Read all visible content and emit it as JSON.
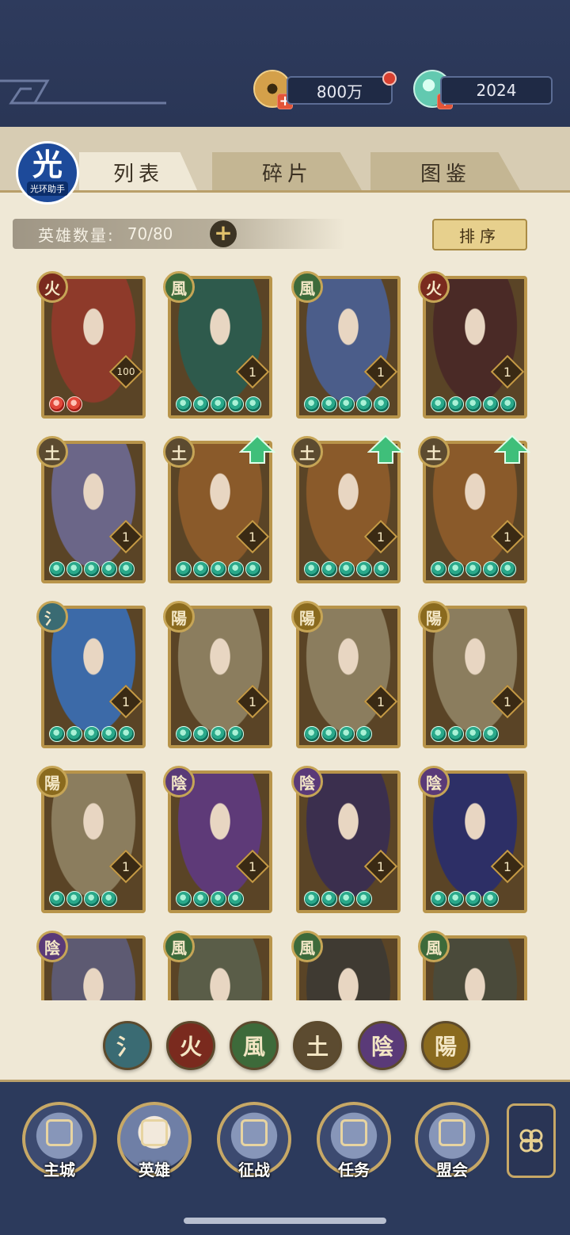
{
  "currencies": {
    "coins": {
      "value": "800万",
      "icon": "coin-icon"
    },
    "jade": {
      "value": "2024",
      "icon": "jade-icon"
    }
  },
  "tabs": [
    {
      "label": "列表",
      "active": true
    },
    {
      "label": "碎片",
      "active": false
    },
    {
      "label": "图鉴",
      "active": false
    }
  ],
  "watermark": {
    "big": "光",
    "small": "光环助手"
  },
  "hero_count": {
    "label": "英雄数量:",
    "value": "70/80"
  },
  "sort_label": "排序",
  "elements": {
    "water": {
      "glyph": "氵",
      "color": "#3a6b73"
    },
    "fire": {
      "glyph": "火",
      "color": "#7a2a1e"
    },
    "wind": {
      "glyph": "風",
      "color": "#3d6a3a"
    },
    "earth": {
      "glyph": "土",
      "color": "#5c4b30"
    },
    "yin": {
      "glyph": "陰",
      "color": "#5a3a78"
    },
    "yang": {
      "glyph": "陽",
      "color": "#8a6a1e"
    }
  },
  "heroes": [
    {
      "element": "fire",
      "level": "100",
      "stars": 2,
      "star_color": "red",
      "upgrade": false,
      "art": "#8e3a2a"
    },
    {
      "element": "wind",
      "level": "1",
      "stars": 5,
      "star_color": "green",
      "upgrade": false,
      "art": "#2e5a4c"
    },
    {
      "element": "wind",
      "level": "1",
      "stars": 5,
      "star_color": "green",
      "upgrade": false,
      "art": "#4b5d8a"
    },
    {
      "element": "fire",
      "level": "1",
      "stars": 5,
      "star_color": "green",
      "upgrade": false,
      "art": "#4a2a26"
    },
    {
      "element": "earth",
      "level": "1",
      "stars": 5,
      "star_color": "green",
      "upgrade": false,
      "art": "#6b6688"
    },
    {
      "element": "earth",
      "level": "1",
      "stars": 5,
      "star_color": "green",
      "upgrade": true,
      "art": "#8a5a2a"
    },
    {
      "element": "earth",
      "level": "1",
      "stars": 5,
      "star_color": "green",
      "upgrade": true,
      "art": "#8a5a2a"
    },
    {
      "element": "earth",
      "level": "1",
      "stars": 5,
      "star_color": "green",
      "upgrade": true,
      "art": "#8a5a2a"
    },
    {
      "element": "water",
      "level": "1",
      "stars": 5,
      "star_color": "green",
      "upgrade": false,
      "art": "#3c6aa8"
    },
    {
      "element": "yang",
      "level": "1",
      "stars": 4,
      "star_color": "green",
      "upgrade": false,
      "art": "#8b7d5e"
    },
    {
      "element": "yang",
      "level": "1",
      "stars": 4,
      "star_color": "green",
      "upgrade": false,
      "art": "#8b7d5e"
    },
    {
      "element": "yang",
      "level": "1",
      "stars": 4,
      "star_color": "green",
      "upgrade": false,
      "art": "#8b7d5e"
    },
    {
      "element": "yang",
      "level": "1",
      "stars": 4,
      "star_color": "green",
      "upgrade": false,
      "art": "#8b7d5e"
    },
    {
      "element": "yin",
      "level": "1",
      "stars": 4,
      "star_color": "green",
      "upgrade": false,
      "art": "#5e3a78"
    },
    {
      "element": "yin",
      "level": "1",
      "stars": 4,
      "star_color": "green",
      "upgrade": false,
      "art": "#3b2f4e"
    },
    {
      "element": "yin",
      "level": "1",
      "stars": 4,
      "star_color": "green",
      "upgrade": false,
      "art": "#2d2f66"
    },
    {
      "element": "yin",
      "level": "",
      "stars": 0,
      "star_color": "green",
      "upgrade": false,
      "art": "#5d5a72"
    },
    {
      "element": "wind",
      "level": "",
      "stars": 0,
      "star_color": "green",
      "upgrade": false,
      "art": "#5a5d48"
    },
    {
      "element": "wind",
      "level": "",
      "stars": 0,
      "star_color": "green",
      "upgrade": false,
      "art": "#3f3a32"
    },
    {
      "element": "wind",
      "level": "",
      "stars": 0,
      "star_color": "green",
      "upgrade": false,
      "art": "#4a4a3a"
    }
  ],
  "filters": [
    "water",
    "fire",
    "wind",
    "earth",
    "yin",
    "yang"
  ],
  "nav": [
    {
      "label": "主城",
      "icon": "palace-icon"
    },
    {
      "label": "英雄",
      "icon": "hero-portrait-icon"
    },
    {
      "label": "征战",
      "icon": "battle-drum-icon"
    },
    {
      "label": "任务",
      "icon": "task-scroll-icon"
    },
    {
      "label": "盟会",
      "icon": "alliance-gate-icon"
    }
  ],
  "menu_icon": "flower-menu-icon"
}
